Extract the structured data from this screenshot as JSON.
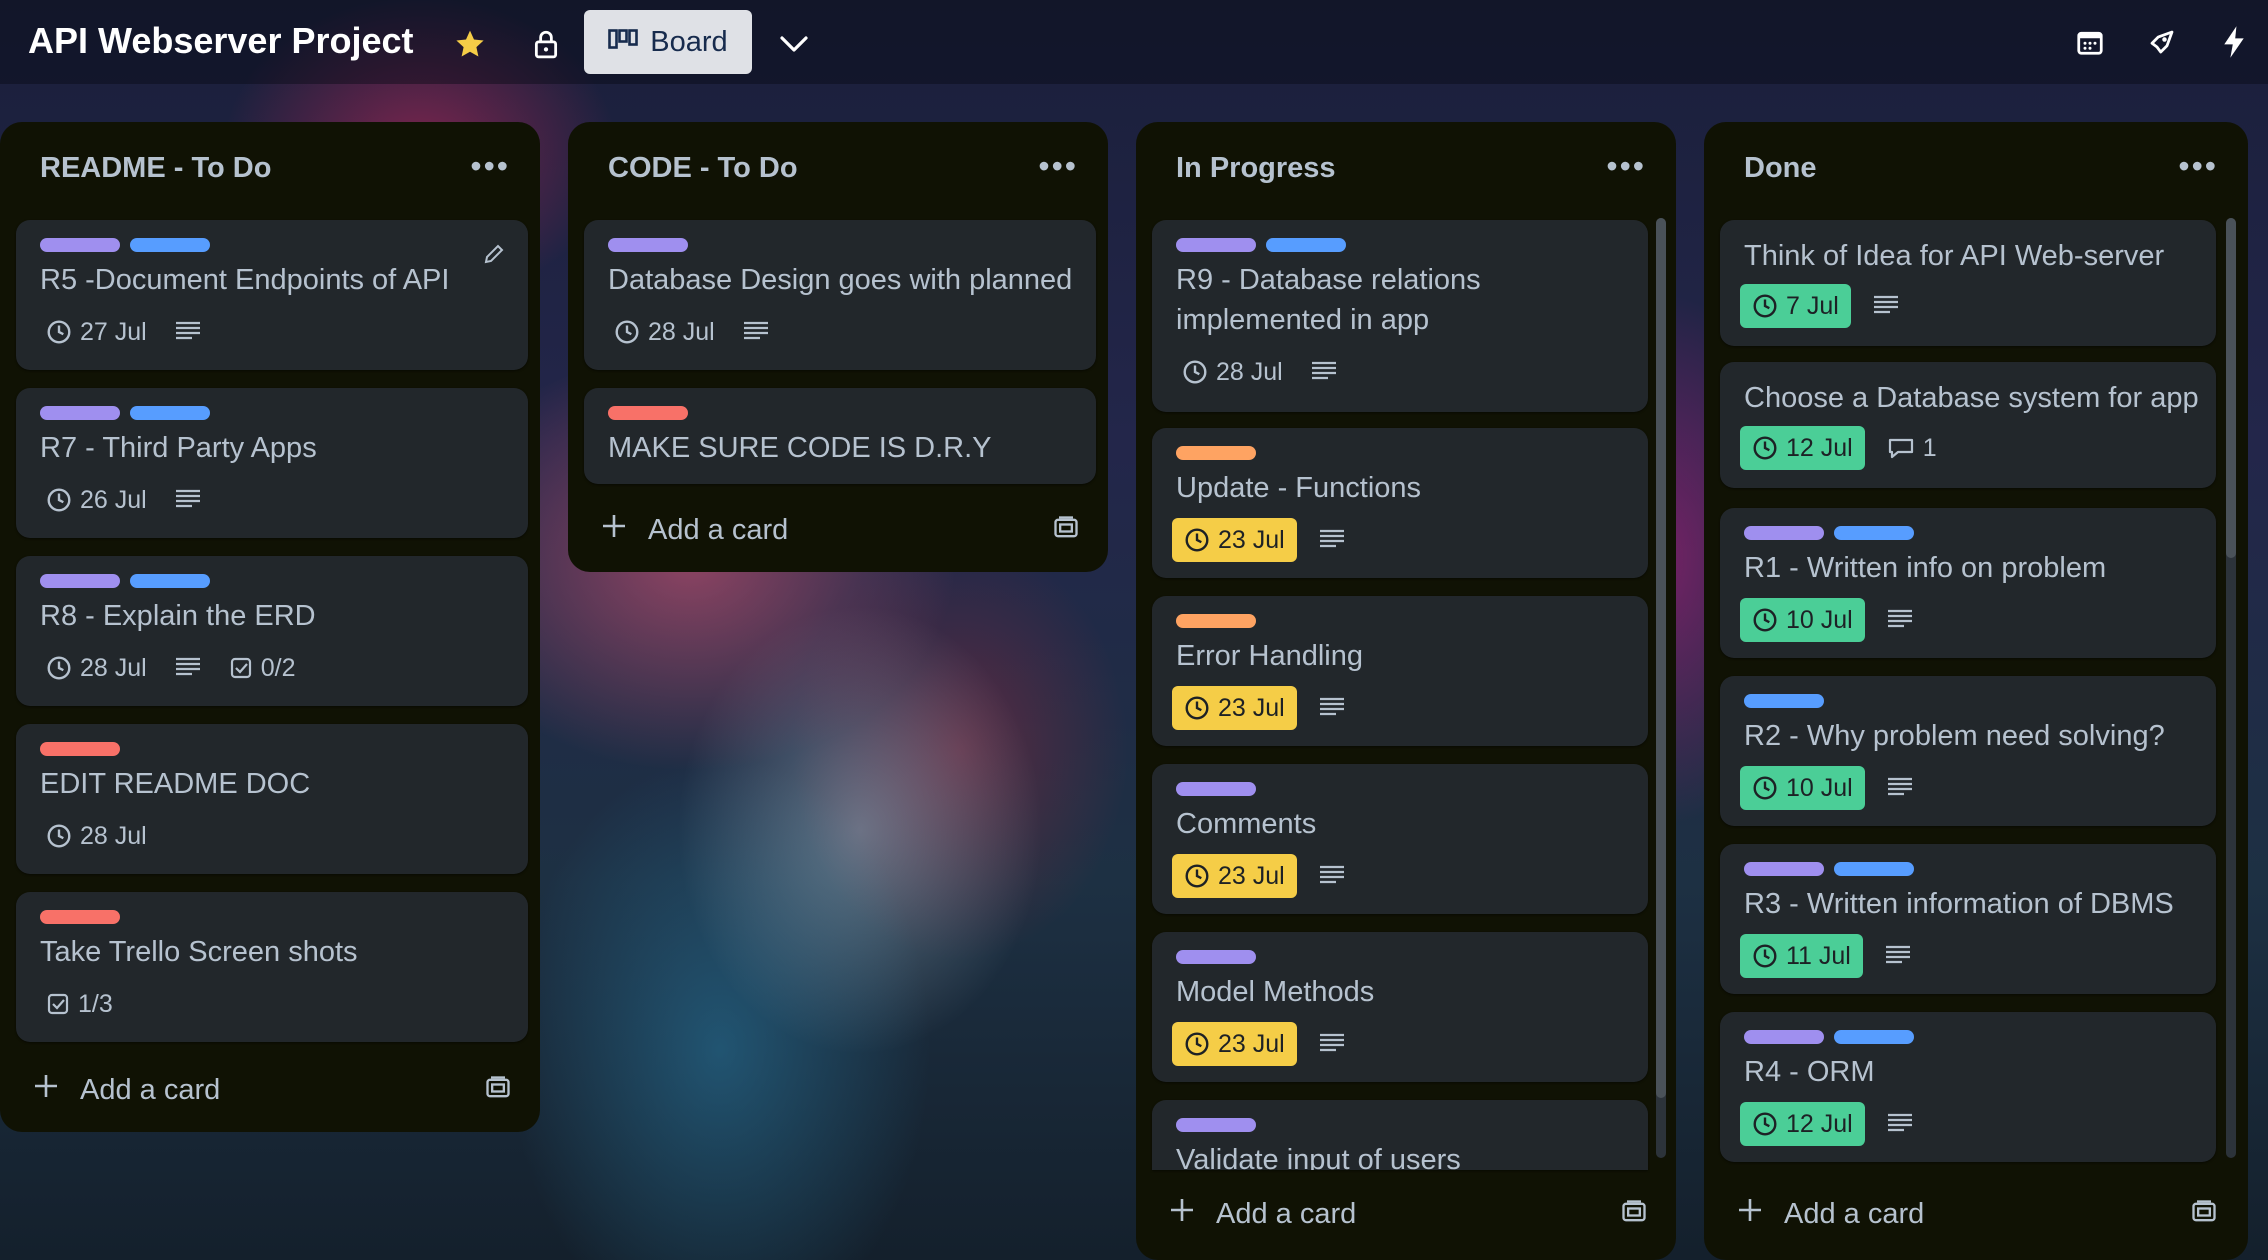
{
  "header": {
    "board_title": "API Webserver Project",
    "view_button_label": "Board",
    "star_color": "#f5cd47",
    "icons": [
      "star-icon",
      "lock-icon",
      "board-icon",
      "chevron-down-icon",
      "calendar-icon",
      "rocket-icon",
      "lightning-icon"
    ]
  },
  "lists": [
    {
      "title": "README - To Do",
      "add_card": "Add a card",
      "cards": [
        {
          "labels": [
            "purple",
            "blue"
          ],
          "title": "R5 -Document Endpoints of API",
          "date": "27 Jul",
          "has_description": true
        },
        {
          "labels": [
            "purple",
            "blue"
          ],
          "title": "R7 - Third Party Apps",
          "date": "26 Jul",
          "has_description": true
        },
        {
          "labels": [
            "purple",
            "blue"
          ],
          "title": "R8 - Explain the ERD",
          "date": "28 Jul",
          "has_description": true,
          "checklist": "0/2"
        },
        {
          "labels": [
            "red"
          ],
          "title": "EDIT README DOC",
          "date": "28 Jul"
        },
        {
          "labels": [
            "red"
          ],
          "title": "Take Trello Screen shots",
          "checklist": "1/3"
        }
      ]
    },
    {
      "title": "CODE - To Do",
      "add_card": "Add a card",
      "cards": [
        {
          "labels": [
            "purple"
          ],
          "title": "Database Design goes with planned",
          "date": "28 Jul",
          "has_description": true
        },
        {
          "labels": [
            "red"
          ],
          "title": "MAKE SURE CODE IS D.R.Y"
        }
      ]
    },
    {
      "title": "In Progress",
      "add_card": "Add a card",
      "cards": [
        {
          "labels": [
            "purple",
            "blue"
          ],
          "title_lines": [
            "R9 - Database relations",
            "implemented in app"
          ],
          "date": "28 Jul",
          "has_description": true
        },
        {
          "labels": [
            "orange"
          ],
          "title": "Update - Functions",
          "date": "23 Jul",
          "date_status": "due-soon",
          "has_description": true
        },
        {
          "labels": [
            "orange"
          ],
          "title": "Error Handling",
          "date": "23 Jul",
          "date_status": "due-soon",
          "has_description": true
        },
        {
          "labels": [
            "purple"
          ],
          "title": "Comments",
          "date": "23 Jul",
          "date_status": "due-soon",
          "has_description": true
        },
        {
          "labels": [
            "purple"
          ],
          "title": "Model Methods",
          "date": "23 Jul",
          "date_status": "due-soon",
          "has_description": true
        },
        {
          "labels": [
            "purple"
          ],
          "title": "Validate input of users"
        }
      ]
    },
    {
      "title": "Done",
      "add_card": "Add a card",
      "cards": [
        {
          "labels": [],
          "title": "Think of Idea for API Web-server",
          "date": "7 Jul",
          "date_status": "complete",
          "has_description": true
        },
        {
          "labels": [],
          "title": "Choose a Database system for app",
          "date": "12 Jul",
          "date_status": "complete",
          "comments": "1"
        },
        {
          "labels": [
            "purple",
            "blue"
          ],
          "title": "R1 - Written info on problem",
          "date": "10 Jul",
          "date_status": "complete",
          "has_description": true
        },
        {
          "labels": [
            "blue"
          ],
          "title": "R2 - Why problem need solving?",
          "date": "10 Jul",
          "date_status": "complete",
          "has_description": true
        },
        {
          "labels": [
            "purple",
            "blue"
          ],
          "title": "R3 - Written information of DBMS",
          "date": "11 Jul",
          "date_status": "complete",
          "has_description": true
        },
        {
          "labels": [
            "purple",
            "blue"
          ],
          "title": "R4 - ORM",
          "date": "12 Jul",
          "date_status": "complete",
          "has_description": true
        }
      ]
    }
  ],
  "colors": {
    "label_purple": "#9f8fef",
    "label_blue": "#579dff",
    "label_red": "#f87168",
    "label_orange": "#fea362",
    "due_soon": "#f5cd47",
    "complete": "#4bce97",
    "list_bg": "#101204",
    "card_bg": "#22272b"
  }
}
